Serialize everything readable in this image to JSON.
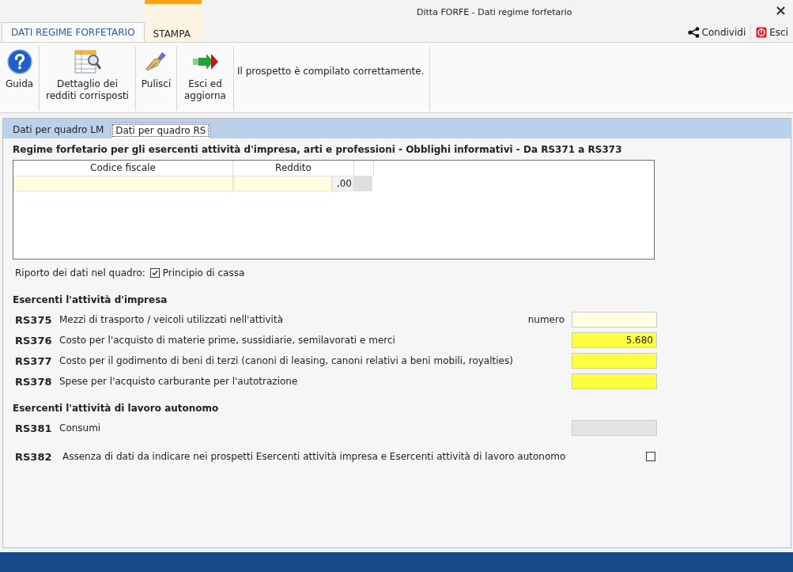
{
  "window": {
    "title": "Ditta FORFE - Dati regime forfetario",
    "close": "×"
  },
  "ribbon_tabs": [
    {
      "label": "DATI REGIME FORFETARIO",
      "selected": true
    },
    {
      "label": "STAMPA",
      "selected": false
    }
  ],
  "header_actions": [
    {
      "kind": "share",
      "label": "Condividi"
    },
    {
      "kind": "exit",
      "label": "Esci"
    }
  ],
  "toolbar": {
    "buttons": [
      {
        "kind": "help",
        "label": "Guida"
      },
      {
        "kind": "detail",
        "label": "Dettaglio dei redditi corrisposti"
      },
      {
        "kind": "clean",
        "label": "Pulisci"
      },
      {
        "kind": "exit",
        "label": "Esci ed aggiorna"
      }
    ],
    "message": "Il prospetto è compilato correttamente."
  },
  "section_tabs": [
    {
      "label": "Dati per quadro LM",
      "selected": false
    },
    {
      "label": "Dati per quadro RS",
      "selected": true
    }
  ],
  "section_title": "Regime forfetario per gli esercenti attività d'impresa, arti e professioni - Obblighi informativi - Da RS371 a RS373",
  "table": {
    "columns": [
      "Codice fiscale",
      "Reddito"
    ],
    "rows": [
      {
        "decimals": ",00"
      }
    ]
  },
  "report": {
    "label": "Riporto dei dati nel quadro:",
    "option": {
      "label": "Principio di cassa",
      "checked": true
    }
  },
  "groups": [
    {
      "title": "Esercenti l'attività d'impresa",
      "rows": [
        {
          "kind": "field",
          "code": "RS375",
          "label": "Mezzi di trasporto / veicoli utilizzati nell'attività",
          "unit": "numero",
          "highlighted": false,
          "disabled": false
        },
        {
          "kind": "field",
          "code": "RS376",
          "label": "Costo per l'acquisto di materie prime, sussidiarie, semilavorati e merci",
          "value": "5.680",
          "highlighted": true,
          "disabled": false
        },
        {
          "kind": "field",
          "code": "RS377",
          "label": "Costo per il godimento di beni di terzi (canoni di leasing, canoni relativi a beni mobili, royalties)",
          "highlighted": true,
          "disabled": false
        },
        {
          "kind": "field",
          "code": "RS378",
          "label": "Spese per l'acquisto carburante per l'autotrazione",
          "highlighted": true,
          "disabled": false
        }
      ]
    },
    {
      "title": "Esercenti l'attività di lavoro autonomo",
      "rows": [
        {
          "kind": "field",
          "code": "RS381",
          "label": "Consumi",
          "disabled": true
        },
        {
          "kind": "checkbox",
          "code": "RS382",
          "label": "Assenza di dati da indicare nei prospetti Esercenti attività impresa e Esercenti attività di lavoro autonomo",
          "checked": false
        }
      ]
    }
  ]
}
